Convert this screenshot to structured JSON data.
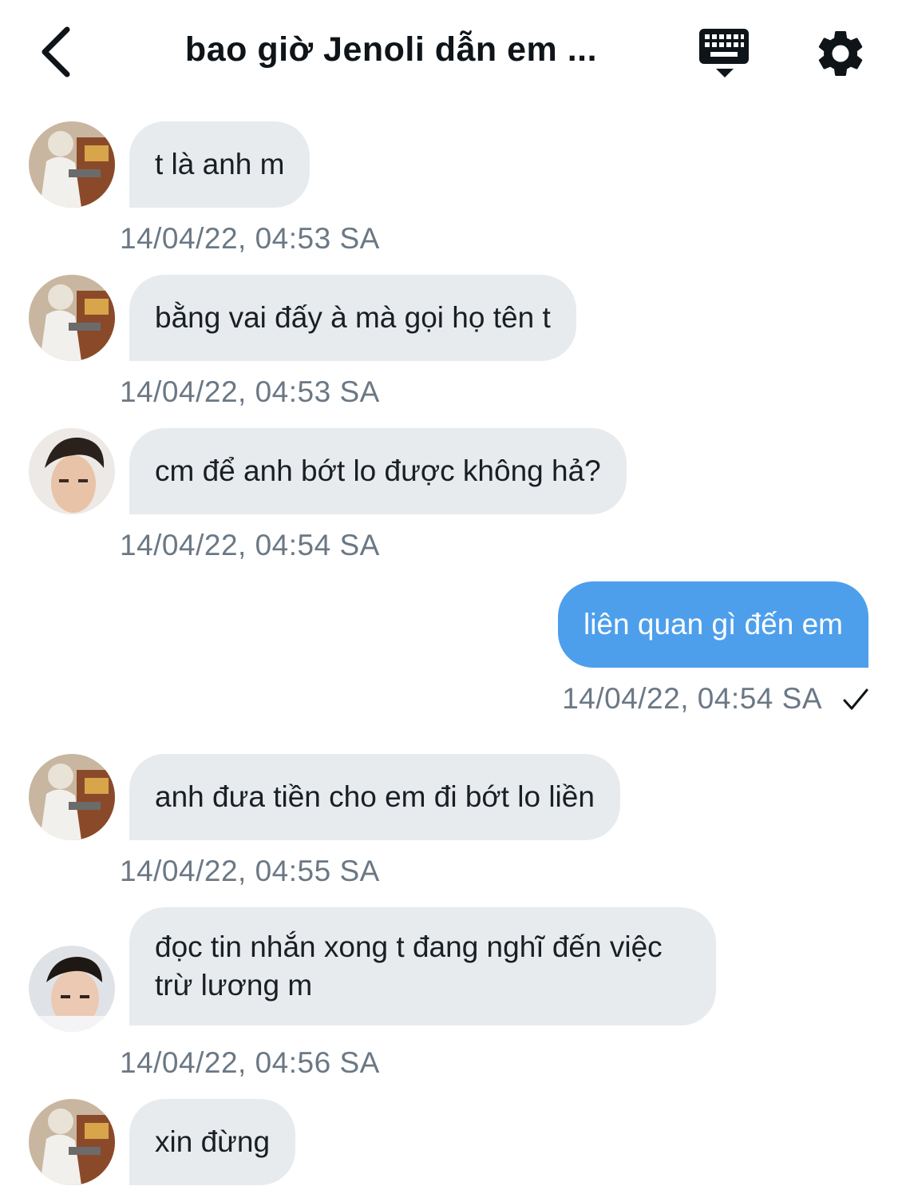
{
  "header": {
    "title": "bao giờ Jenoli dẫn em ...",
    "back_icon": "chevron-left-icon",
    "keyboard_icon": "keyboard-icon",
    "settings_icon": "gear-icon"
  },
  "colors": {
    "incoming_bubble": "#e7ebee",
    "outgoing_bubble": "#4d9fec",
    "timestamp": "#6b7885"
  },
  "messages": [
    {
      "sender": "other",
      "text": "t là anh m",
      "time": "14/04/22, 04:53 SA"
    },
    {
      "sender": "other",
      "text": "bằng vai đấy à mà gọi họ tên t",
      "time": "14/04/22, 04:53 SA"
    },
    {
      "sender": "other",
      "text": "cm để anh bớt lo được không hả?",
      "time": "14/04/22, 04:54 SA"
    },
    {
      "sender": "me",
      "text": "liên quan gì đến em",
      "time": "14/04/22, 04:54 SA",
      "status_icon": "checkmark-icon"
    },
    {
      "sender": "other",
      "text": "anh đưa tiền cho em đi bớt lo liền",
      "time": "14/04/22, 04:55 SA"
    },
    {
      "sender": "other",
      "text": "đọc tin nhắn xong t đang nghĩ đến việc trừ lương m",
      "time": "14/04/22, 04:56 SA"
    },
    {
      "sender": "other",
      "text": "xin đừng",
      "time": ""
    }
  ]
}
